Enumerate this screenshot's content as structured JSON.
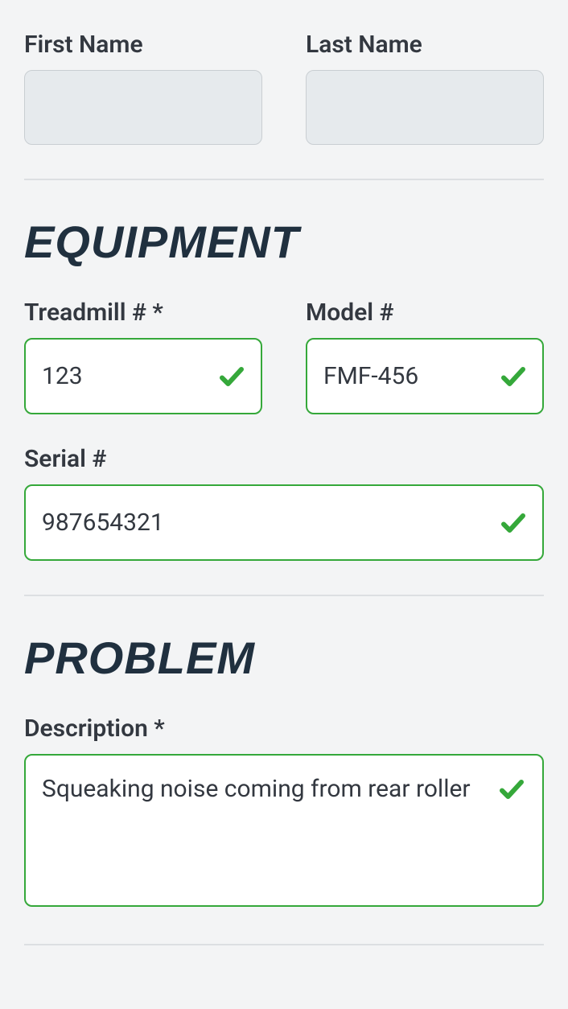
{
  "contact": {
    "first_name_label": "First Name",
    "first_name_value": "",
    "last_name_label": "Last Name",
    "last_name_value": ""
  },
  "sections": {
    "equipment": "EQUIPMENT",
    "problem": "PROBLEM"
  },
  "equipment": {
    "treadmill_label": "Treadmill # *",
    "treadmill_value": "123",
    "model_label": "Model #",
    "model_value": "FMF-456",
    "serial_label": "Serial #",
    "serial_value": "987654321"
  },
  "problem": {
    "description_label": "Description *",
    "description_value": "Squeaking noise coming from rear roller"
  },
  "colors": {
    "valid_border": "#35a83a",
    "check": "#35a83a"
  }
}
